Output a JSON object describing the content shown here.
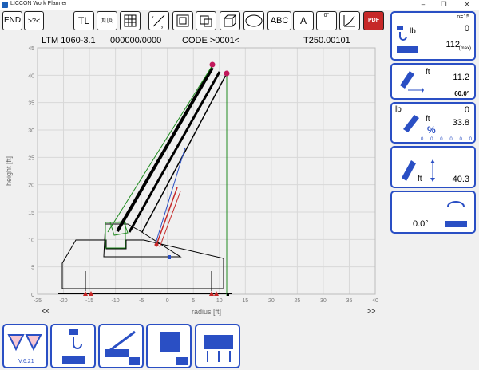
{
  "window": {
    "title": "LICCON Work Planner",
    "controls": [
      "–",
      "❐",
      "✕"
    ]
  },
  "toolbar": {
    "end": "END",
    "help": ">?<",
    "tl": "TL",
    "units": "[ft] [lb]",
    "abc": "ABC",
    "a": "A",
    "angle": "0°",
    "pdf": "PDF"
  },
  "info": {
    "model": "LTM 1060-3.1",
    "number": "000000/0000",
    "code": "CODE >0001<",
    "table": "T250.00101"
  },
  "chart_data": {
    "type": "line",
    "xlabel": "radius [ft]",
    "ylabel": "height [ft]",
    "xlim": [
      -25,
      40
    ],
    "ylim": [
      0,
      45
    ],
    "xticks": [
      -25,
      -20,
      -15,
      -10,
      -5,
      0,
      5,
      10,
      15,
      20,
      25,
      30,
      35,
      40
    ],
    "yticks": [
      0,
      5,
      10,
      15,
      20,
      25,
      30,
      35,
      40,
      45
    ],
    "grid": true,
    "nav_left": "<<",
    "nav_right": ">>"
  },
  "panels": {
    "load": {
      "count_label": "n=15",
      "unit": "lb",
      "value": "0",
      "max_value": "112",
      "max_label": "(max)"
    },
    "radius": {
      "unit": "ft",
      "value": "11.2",
      "angle": "60.0°"
    },
    "percent": {
      "unit_lb": "lb",
      "unit_ft": "ft",
      "value_lb": "0",
      "value_ft": "33.8",
      "percent_sign": "%",
      "scale": [
        "0",
        "0",
        "0",
        "0",
        "0",
        "0"
      ]
    },
    "height": {
      "unit": "ft",
      "value": "40.3"
    },
    "slew": {
      "value": "0.0°"
    }
  },
  "bottom": {
    "version": "V.6.21"
  }
}
